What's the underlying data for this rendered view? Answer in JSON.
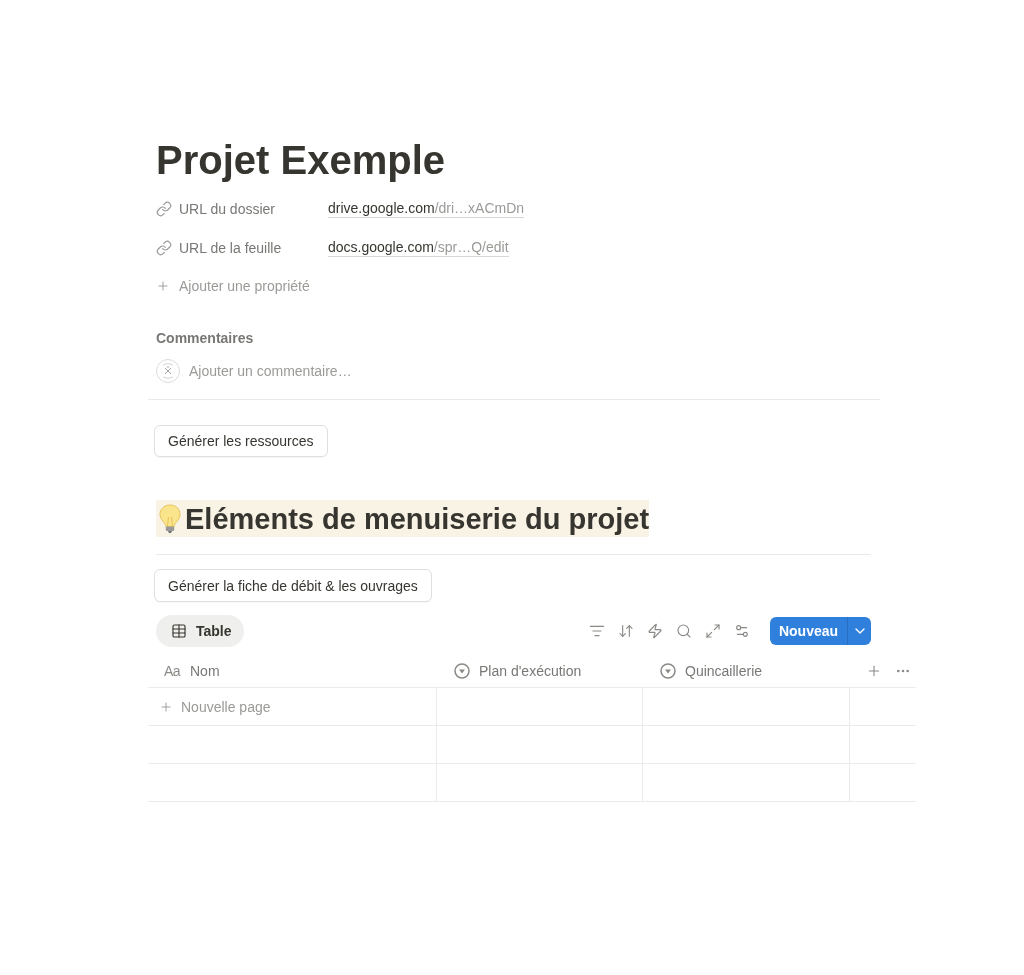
{
  "page": {
    "title": "Projet Exemple"
  },
  "properties": [
    {
      "kind": "url",
      "label": "URL du dossier",
      "host": "drive.google.com",
      "path": "/dri…xACmDn"
    },
    {
      "kind": "url",
      "label": "URL de la feuille",
      "host": "docs.google.com",
      "path": "/spr…Q/edit"
    }
  ],
  "add_property": {
    "label": "Ajouter une propriété"
  },
  "comments": {
    "heading": "Commentaires",
    "placeholder": "Ajouter un commentaire…"
  },
  "action_button": {
    "label": "Générer les ressources"
  },
  "section": {
    "heading": "Eléments de menuiserie du projet",
    "action_button": {
      "label": "Générer la fiche de débit & les ouvrages"
    },
    "views": [
      {
        "label": "Table",
        "selected": true
      }
    ],
    "new_button": {
      "label": "Nouveau"
    },
    "table": {
      "columns": [
        {
          "kind": "title",
          "icon_text": "Aa",
          "label": "Nom"
        },
        {
          "kind": "select",
          "label": "Plan d'exécution"
        },
        {
          "kind": "select",
          "label": "Quincaillerie"
        }
      ],
      "rows": [
        {
          "kind": "new_page",
          "label": "Nouvelle page"
        },
        {
          "kind": "empty"
        },
        {
          "kind": "empty"
        }
      ]
    }
  }
}
